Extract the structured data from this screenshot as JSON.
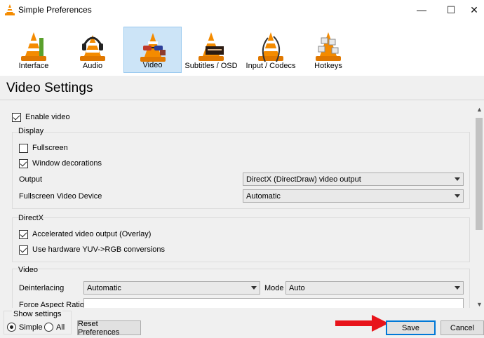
{
  "window": {
    "title": "Simple Preferences",
    "controls": {
      "minimize": "—",
      "maximize": "☐",
      "close": "✕"
    }
  },
  "categories": [
    {
      "id": "interface",
      "label": "Interface",
      "icon": "vlc-cone-interface-icon"
    },
    {
      "id": "audio",
      "label": "Audio",
      "icon": "vlc-cone-headphones-icon"
    },
    {
      "id": "video",
      "label": "Video",
      "icon": "vlc-cone-glasses-icon",
      "selected": true
    },
    {
      "id": "subtitles",
      "label": "Subtitles / OSD",
      "icon": "vlc-cone-subtitles-icon"
    },
    {
      "id": "input",
      "label": "Input / Codecs",
      "icon": "vlc-cone-cable-icon"
    },
    {
      "id": "hotkeys",
      "label": "Hotkeys",
      "icon": "vlc-cone-keys-icon"
    }
  ],
  "section_title": "Video Settings",
  "enable_video": {
    "label": "Enable video",
    "checked": true
  },
  "display": {
    "legend": "Display",
    "fullscreen": {
      "label": "Fullscreen",
      "checked": false
    },
    "window_decorations": {
      "label": "Window decorations",
      "checked": true
    },
    "output": {
      "label": "Output",
      "value": "DirectX (DirectDraw) video output"
    },
    "fullscreen_device": {
      "label": "Fullscreen Video Device",
      "value": "Automatic"
    }
  },
  "directx": {
    "legend": "DirectX",
    "accelerated": {
      "label": "Accelerated video output (Overlay)",
      "checked": true
    },
    "yuv": {
      "label": "Use hardware YUV->RGB conversions",
      "checked": true
    }
  },
  "video": {
    "legend": "Video",
    "deinterlacing": {
      "label": "Deinterlacing",
      "value": "Automatic"
    },
    "mode": {
      "label": "Mode",
      "value": "Auto"
    },
    "aspect_partial": "Force Aspect Ratio"
  },
  "show_settings": {
    "legend": "Show settings",
    "simple": "Simple",
    "all": "All",
    "selected": "simple"
  },
  "buttons": {
    "reset": "Reset Preferences",
    "save": "Save",
    "cancel": "Cancel"
  },
  "colors": {
    "selected_bg": "#cce4f7",
    "selected_border": "#99c9ef",
    "annotation_arrow": "#e8141b",
    "focus": "#0078d7"
  }
}
